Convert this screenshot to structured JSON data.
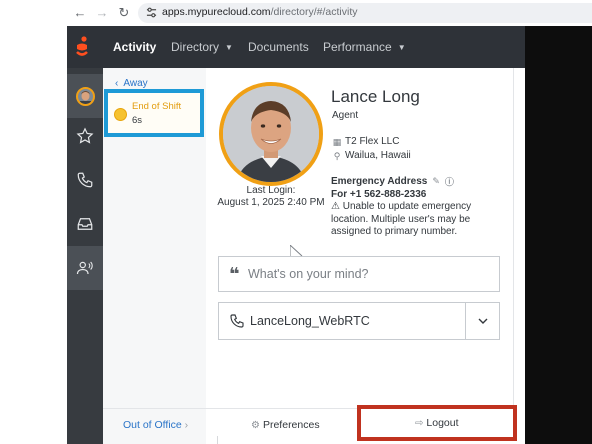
{
  "browser": {
    "url_host": "apps.mypurecloud.com",
    "url_path": "/directory/#/activity"
  },
  "header": {
    "nav": [
      {
        "label": "Activity",
        "active": true,
        "has_menu": false
      },
      {
        "label": "Directory",
        "active": false,
        "has_menu": true
      },
      {
        "label": "Documents",
        "active": false,
        "has_menu": false
      },
      {
        "label": "Performance",
        "active": false,
        "has_menu": true
      }
    ]
  },
  "rail": {
    "items": [
      "avatar",
      "star-icon",
      "phone-icon",
      "inbox-icon",
      "person-voice-icon"
    ]
  },
  "presence": {
    "back_label": "Away",
    "status_name": "End of Shift",
    "status_time": "6s",
    "status_color": "#f6c22f"
  },
  "profile": {
    "name": "Lance Long",
    "title": "Agent",
    "company": "T2 Flex LLC",
    "location": "Wailua, Hawaii",
    "last_login_label": "Last Login:",
    "last_login_date": "August 1, 2025 2:40 PM",
    "emergency_title": "Emergency Address",
    "emergency_number": "For +1 562-888-2336",
    "emergency_warning": "Unable to update emergency location. Multiple user's may be assigned to primary number."
  },
  "status_input": {
    "placeholder": "What's on your mind?"
  },
  "station": {
    "name": "LanceLong_WebRTC"
  },
  "footer": {
    "out_of_office": "Out of Office",
    "preferences": "Preferences",
    "logout": "Logout"
  },
  "colors": {
    "accent_orange": "#f0a015",
    "highlight_blue": "#1e9ad6",
    "highlight_red": "#c0321f",
    "header_bg": "#2e3238"
  }
}
